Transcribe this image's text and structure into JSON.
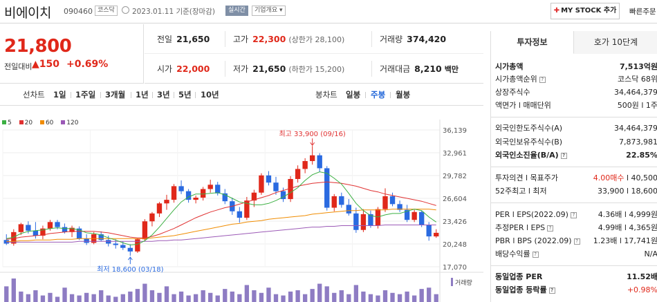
{
  "header": {
    "name": "비에이치",
    "code": "090460",
    "market": "코스닥",
    "date": "2023.01.11",
    "basis": "기준(장마감)",
    "live": "실시간",
    "overview": "기업개요 ▾",
    "mystock": "MY STOCK 추가",
    "quick": "빠른주문"
  },
  "price": {
    "current": "21,800",
    "change_label": "전일대비",
    "change": "▲150",
    "change_pct": "+0.69%"
  },
  "stats": {
    "prev_label": "전일",
    "prev": "21,650",
    "high_label": "고가",
    "high": "22,300",
    "upper": "(상한가 28,100)",
    "volume_label": "거래량",
    "volume": "374,420",
    "open_label": "시가",
    "open": "22,000",
    "low_label": "저가",
    "low": "21,650",
    "lower": "(하한가 15,200)",
    "amount_label": "거래대금",
    "amount": "8,210",
    "amount_unit": "백만"
  },
  "toolbar": {
    "line_chart": "선차트",
    "line_items": [
      "1일",
      "1주일",
      "3개월",
      "1년",
      "3년",
      "5년",
      "10년"
    ],
    "candle_chart": "봉차트",
    "candle_items": [
      "일봉",
      "주봉",
      "월봉"
    ],
    "active_candle": "주봉"
  },
  "legend": [
    {
      "label": "5",
      "color": "#3cb043"
    },
    {
      "label": "20",
      "color": "#e03131"
    },
    {
      "label": "60",
      "color": "#f08c00"
    },
    {
      "label": "120",
      "color": "#9b59b6"
    }
  ],
  "chart_data": {
    "type": "candlestick",
    "interval": "weekly",
    "y_ticks": [
      "36,139",
      "32,961",
      "29,782",
      "26,604",
      "23,426",
      "20,248",
      "17,070"
    ],
    "ylim": [
      17070,
      36139
    ],
    "max_label": "최고 33,900 (09/16)",
    "min_label": "최저 18,600 (03/18)",
    "volume_label": "거래량",
    "candles": [
      {
        "o": 20800,
        "h": 21600,
        "l": 20100,
        "c": 20300
      },
      {
        "o": 20300,
        "h": 22300,
        "l": 20000,
        "c": 21900
      },
      {
        "o": 21900,
        "h": 23200,
        "l": 21500,
        "c": 23000
      },
      {
        "o": 22900,
        "h": 23400,
        "l": 21700,
        "c": 22100
      },
      {
        "o": 22100,
        "h": 23300,
        "l": 21000,
        "c": 21400
      },
      {
        "o": 21400,
        "h": 22800,
        "l": 20900,
        "c": 22400
      },
      {
        "o": 22400,
        "h": 23600,
        "l": 22100,
        "c": 23300
      },
      {
        "o": 23300,
        "h": 23600,
        "l": 22300,
        "c": 22600
      },
      {
        "o": 22600,
        "h": 23100,
        "l": 21700,
        "c": 21900
      },
      {
        "o": 21900,
        "h": 22800,
        "l": 21200,
        "c": 22500
      },
      {
        "o": 22400,
        "h": 22700,
        "l": 20800,
        "c": 21000
      },
      {
        "o": 21000,
        "h": 21600,
        "l": 20100,
        "c": 20400
      },
      {
        "o": 20400,
        "h": 21900,
        "l": 20200,
        "c": 21600
      },
      {
        "o": 21600,
        "h": 22000,
        "l": 20600,
        "c": 20800
      },
      {
        "o": 20800,
        "h": 21400,
        "l": 19900,
        "c": 20300
      },
      {
        "o": 20300,
        "h": 20900,
        "l": 19600,
        "c": 20100
      },
      {
        "o": 20100,
        "h": 20600,
        "l": 19400,
        "c": 19700
      },
      {
        "o": 19700,
        "h": 20200,
        "l": 18600,
        "c": 19200
      },
      {
        "o": 19200,
        "h": 21000,
        "l": 19000,
        "c": 20900
      },
      {
        "o": 20900,
        "h": 23700,
        "l": 20700,
        "c": 23400
      },
      {
        "o": 23400,
        "h": 24700,
        "l": 22700,
        "c": 24500
      },
      {
        "o": 24500,
        "h": 26100,
        "l": 24000,
        "c": 25900
      },
      {
        "o": 25900,
        "h": 27100,
        "l": 25000,
        "c": 26400
      },
      {
        "o": 26400,
        "h": 28600,
        "l": 26000,
        "c": 28300
      },
      {
        "o": 28300,
        "h": 29100,
        "l": 27200,
        "c": 27600
      },
      {
        "o": 27600,
        "h": 27900,
        "l": 26000,
        "c": 26400
      },
      {
        "o": 26400,
        "h": 27000,
        "l": 25900,
        "c": 26700
      },
      {
        "o": 26700,
        "h": 28200,
        "l": 26300,
        "c": 27900
      },
      {
        "o": 27900,
        "h": 29200,
        "l": 27400,
        "c": 28500
      },
      {
        "o": 28500,
        "h": 28900,
        "l": 27000,
        "c": 27300
      },
      {
        "o": 27300,
        "h": 27900,
        "l": 25800,
        "c": 26200
      },
      {
        "o": 26200,
        "h": 26700,
        "l": 24300,
        "c": 24800
      },
      {
        "o": 24800,
        "h": 25400,
        "l": 23200,
        "c": 23900
      },
      {
        "o": 23900,
        "h": 26800,
        "l": 23600,
        "c": 26300
      },
      {
        "o": 26300,
        "h": 27800,
        "l": 25400,
        "c": 27400
      },
      {
        "o": 27400,
        "h": 30100,
        "l": 27100,
        "c": 29800
      },
      {
        "o": 29800,
        "h": 30400,
        "l": 28400,
        "c": 28800
      },
      {
        "o": 28800,
        "h": 29600,
        "l": 27100,
        "c": 27600
      },
      {
        "o": 27600,
        "h": 28100,
        "l": 26100,
        "c": 26500
      },
      {
        "o": 26500,
        "h": 29700,
        "l": 26100,
        "c": 29300
      },
      {
        "o": 29300,
        "h": 31200,
        "l": 28800,
        "c": 30700
      },
      {
        "o": 30700,
        "h": 32200,
        "l": 30100,
        "c": 31800
      },
      {
        "o": 31800,
        "h": 33900,
        "l": 31300,
        "c": 32600
      },
      {
        "o": 32600,
        "h": 32900,
        "l": 30300,
        "c": 30800
      },
      {
        "o": 30800,
        "h": 31100,
        "l": 24900,
        "c": 25300
      },
      {
        "o": 25300,
        "h": 27200,
        "l": 24800,
        "c": 26900
      },
      {
        "o": 26900,
        "h": 27400,
        "l": 25300,
        "c": 25700
      },
      {
        "o": 25700,
        "h": 26500,
        "l": 24200,
        "c": 24500
      },
      {
        "o": 24500,
        "h": 25300,
        "l": 21800,
        "c": 22200
      },
      {
        "o": 22200,
        "h": 25100,
        "l": 21900,
        "c": 24400
      },
      {
        "o": 24400,
        "h": 24900,
        "l": 22500,
        "c": 22800
      },
      {
        "o": 22800,
        "h": 25400,
        "l": 22400,
        "c": 25100
      },
      {
        "o": 25100,
        "h": 28000,
        "l": 24700,
        "c": 26900
      },
      {
        "o": 26900,
        "h": 27400,
        "l": 25500,
        "c": 25800
      },
      {
        "o": 25800,
        "h": 26300,
        "l": 24700,
        "c": 25000
      },
      {
        "o": 25000,
        "h": 25700,
        "l": 23300,
        "c": 23600
      },
      {
        "o": 23600,
        "h": 25000,
        "l": 23300,
        "c": 24700
      },
      {
        "o": 24700,
        "h": 24900,
        "l": 22600,
        "c": 22900
      },
      {
        "o": 22900,
        "h": 23300,
        "l": 20700,
        "c": 21300
      },
      {
        "o": 21300,
        "h": 22300,
        "l": 21100,
        "c": 21800
      }
    ],
    "ma5": [
      21000,
      21200,
      21700,
      22000,
      22100,
      22200,
      22400,
      22500,
      22400,
      22400,
      22200,
      21800,
      21700,
      21500,
      21100,
      20800,
      20400,
      20100,
      20200,
      20700,
      21500,
      22600,
      23800,
      25000,
      26100,
      26800,
      27200,
      27200,
      27300,
      27400,
      27100,
      26600,
      26100,
      25900,
      25700,
      25700,
      25900,
      26300,
      26800,
      27400,
      28100,
      29100,
      29900,
      30300,
      30100,
      29400,
      28600,
      27300,
      25900,
      24900,
      24200,
      24000,
      24300,
      24500,
      24500,
      24800,
      25100,
      24900,
      24000,
      23300
    ],
    "ma20": [
      20900,
      21000,
      21200,
      21300,
      21400,
      21500,
      21700,
      21800,
      21900,
      22000,
      22000,
      22000,
      22000,
      21900,
      21800,
      21600,
      21400,
      21200,
      21100,
      21100,
      21300,
      21600,
      22000,
      22400,
      22900,
      23400,
      23900,
      24300,
      24700,
      25000,
      25300,
      25500,
      25800,
      26100,
      26400,
      26700,
      27000,
      27400,
      27700,
      28000,
      28300,
      28500,
      28700,
      28800,
      28900,
      28800,
      28700,
      28500,
      28300,
      28000,
      27700,
      27500,
      27200,
      27000,
      26800,
      26600,
      26400,
      26200,
      25900,
      25600
    ],
    "ma60": [
      20600,
      20600,
      20700,
      20700,
      20800,
      20800,
      20800,
      20900,
      20900,
      20900,
      21000,
      21000,
      21000,
      21000,
      21000,
      21000,
      21000,
      21000,
      21000,
      21000,
      21100,
      21200,
      21300,
      21400,
      21600,
      21800,
      22000,
      22200,
      22400,
      22600,
      22800,
      23000,
      23100,
      23300,
      23400,
      23500,
      23700,
      23800,
      23900,
      24000,
      24100,
      24200,
      24400,
      24500,
      24600,
      24700,
      24800,
      24900,
      24900,
      25000,
      25000,
      25000,
      25000,
      25100,
      25100,
      25100,
      25100,
      25100,
      25100,
      25000
    ],
    "ma120": [
      20500,
      20500,
      20500,
      20500,
      20500,
      20500,
      20500,
      20500,
      20500,
      20500,
      20600,
      20600,
      20600,
      20600,
      20600,
      20600,
      20600,
      20600,
      20600,
      20600,
      20600,
      20700,
      20700,
      20800,
      20800,
      20900,
      21000,
      21100,
      21200,
      21300,
      21400,
      21500,
      21600,
      21700,
      21800,
      21900,
      22000,
      22100,
      22200,
      22300,
      22400,
      22500,
      22600,
      22600,
      22700,
      22700,
      22800,
      22800,
      22800,
      22800,
      22800,
      22800,
      22900,
      22900,
      22900,
      22900,
      22900,
      22900,
      22900,
      22900
    ],
    "volume": [
      12,
      18,
      8,
      6,
      9,
      5,
      7,
      4,
      11,
      6,
      5,
      7,
      6,
      9,
      5,
      4,
      6,
      8,
      10,
      14,
      9,
      7,
      12,
      6,
      8,
      5,
      6,
      9,
      7,
      5,
      10,
      8,
      6,
      13,
      9,
      7,
      11,
      6,
      5,
      8,
      9,
      6,
      10,
      14,
      12,
      7,
      9,
      6,
      13,
      8,
      6,
      5,
      9,
      7,
      6,
      8,
      5,
      10,
      11,
      6
    ]
  },
  "side": {
    "tab_invest": "투자정보",
    "tab_quote": "호가 10단계",
    "rows": {
      "market_cap_label": "시가총액",
      "market_cap": "7,513억원",
      "cap_rank_label": "시가총액순위",
      "cap_rank": "코스닥 68위",
      "shares_label": "상장주식수",
      "shares": "34,464,379",
      "face_label": "액면가 l 매매단위",
      "face": "500원 l 1주",
      "foreign_limit_label": "외국인한도주식수(A)",
      "foreign_limit": "34,464,379",
      "foreign_hold_label": "외국인보유주식수(B)",
      "foreign_hold": "7,873,981",
      "foreign_ratio_label": "외국인소진율(B/A)",
      "foreign_ratio": "22.85%",
      "opinion_label": "투자의견 l 목표주가",
      "opinion": "4.00매수",
      "target": "l 40,500",
      "week52_label": "52주최고 l 최저",
      "week52": "33,900 l 18,600",
      "per_label": "PER l EPS(2022.09)",
      "per": "4.36배 l 4,999원",
      "est_per_label": "추정PER l EPS",
      "est_per": "4.99배 l 4,365원",
      "pbr_label": "PBR l BPS (2022.09)",
      "pbr": "1.23배 l 17,741원",
      "div_label": "배당수익률",
      "div": "N/A",
      "ind_per_label": "동일업종 PER",
      "ind_per": "11.52배",
      "ind_rate_label": "동일업종 등락률",
      "ind_rate": "+0.98%"
    }
  }
}
